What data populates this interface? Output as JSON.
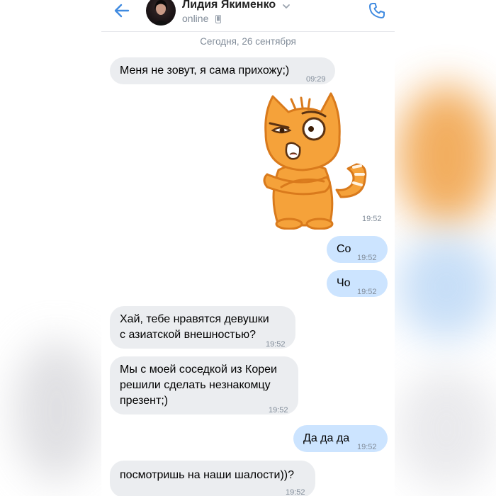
{
  "header": {
    "contact_name": "Лидия Якименко",
    "status": "online",
    "icons": {
      "back": "arrow-left-icon",
      "chevron": "chevron-down-icon",
      "mobile": "mobile-phone-icon",
      "call": "phone-icon"
    }
  },
  "chat": {
    "date_separator": "Сегодня, 26 сентября",
    "sticker": {
      "description_icon": "angry-cat-sticker",
      "time": "19:52"
    },
    "messages": [
      {
        "direction": "in",
        "text": "Меня не зовут, я сама прихожу;)",
        "time": "09:29"
      },
      {
        "direction": "out",
        "text": "Со",
        "time": "19:52"
      },
      {
        "direction": "out",
        "text": "Чо",
        "time": "19:52"
      },
      {
        "direction": "in",
        "text": "Хай, тебе нравятся девушки с азиатской внешностью?",
        "time": "19:52"
      },
      {
        "direction": "in",
        "text": "Мы с моей соседкой из Кореи решили сделать незнакомцу презент;)",
        "time": "19:52"
      },
      {
        "direction": "out",
        "text": "Да да да",
        "time": "19:52"
      },
      {
        "direction": "in",
        "text": "посмотришь на наши шалости))?",
        "time": "19:52"
      }
    ]
  },
  "colors": {
    "accent": "#3f8ae0",
    "incoming_bubble": "#ebedf0",
    "outgoing_bubble": "#cce4ff",
    "secondary_text": "#818c99",
    "sticker_orange": "#f5a23a"
  }
}
